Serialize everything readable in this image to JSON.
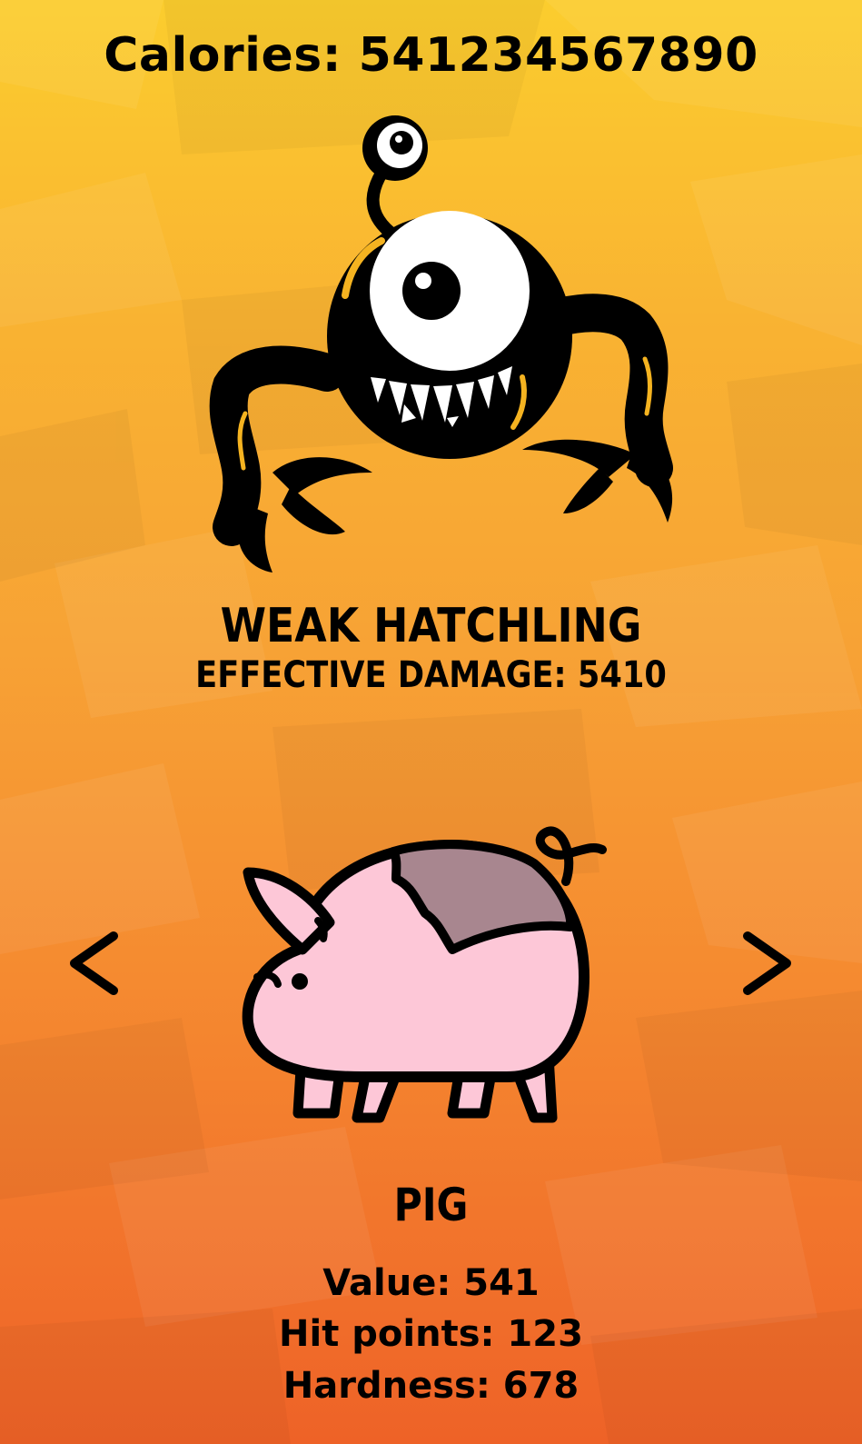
{
  "hud": {
    "calories_text": "Calories: 541234567890"
  },
  "monster": {
    "name": "WEAK HATCHLING",
    "damage_text": "EFFECTIVE DAMAGE: 5410",
    "icon": "one-eyed-hatchling-monster"
  },
  "food": {
    "name": "PIG",
    "icon": "pig-icon",
    "stats": {
      "value_text": "Value: 541",
      "hit_points_text": "Hit points: 123",
      "hardness_text": "Hardness: 678"
    }
  },
  "navigation": {
    "prev_icon": "chevron-left-icon",
    "next_icon": "chevron-right-icon"
  },
  "colors": {
    "background_top": "#fbcd2e",
    "background_bottom": "#ee6227",
    "pig_body": "#fdc7d7",
    "pig_spot": "#a8868f",
    "ink": "#000000"
  }
}
